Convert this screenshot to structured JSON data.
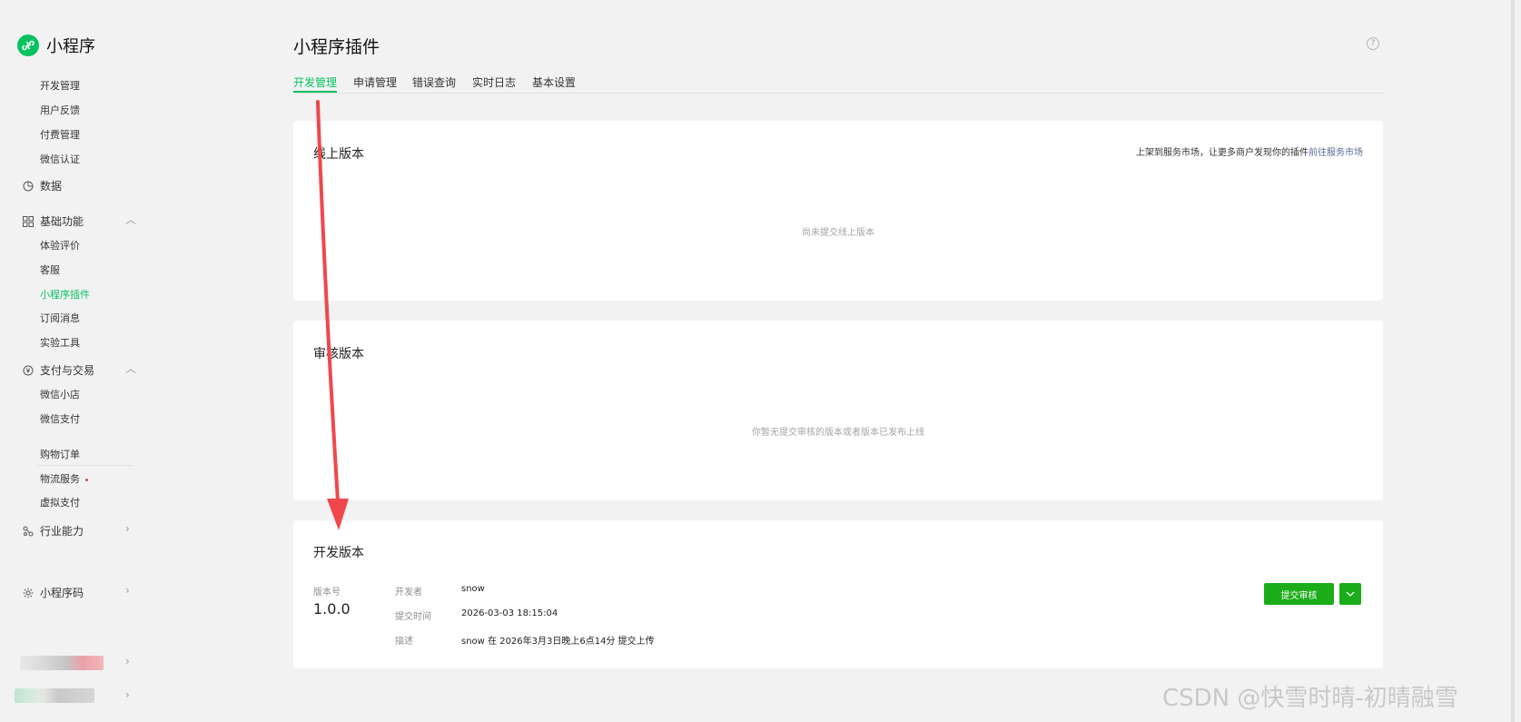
{
  "app": {
    "name": "小程序"
  },
  "sidebar": {
    "items_top": [
      {
        "label": "开发管理"
      },
      {
        "label": "用户反馈"
      },
      {
        "label": "付费管理"
      },
      {
        "label": "微信认证"
      }
    ],
    "data_group": {
      "label": "数据"
    },
    "basic_group": {
      "label": "基础功能"
    },
    "basic_items": [
      {
        "label": "体验评价"
      },
      {
        "label": "客服"
      },
      {
        "label": "小程序插件"
      },
      {
        "label": "订阅消息"
      },
      {
        "label": "实验工具"
      }
    ],
    "pay_group": {
      "label": "支付与交易"
    },
    "pay_items": [
      {
        "label": "微信小店"
      },
      {
        "label": "微信支付"
      },
      {
        "label": "购物订单"
      },
      {
        "label": "物流服务"
      },
      {
        "label": "虚拟支付"
      }
    ],
    "industry_group": {
      "label": "行业能力"
    },
    "qrcode_group": {
      "label": "小程序码"
    }
  },
  "page": {
    "title": "小程序插件",
    "tabs": [
      {
        "label": "开发管理"
      },
      {
        "label": "申请管理"
      },
      {
        "label": "错误查询"
      },
      {
        "label": "实时日志"
      },
      {
        "label": "基本设置"
      }
    ]
  },
  "online": {
    "title": "线上版本",
    "market_text": "上架到服务市场，让更多商户发现你的插件",
    "market_link": "前往服务市场",
    "empty": "尚未提交线上版本"
  },
  "review": {
    "title": "审核版本",
    "empty": "你暂无提交审核的版本或者版本已发布上线"
  },
  "dev": {
    "title": "开发版本",
    "version_label": "版本号",
    "version": "1.0.0",
    "developer_label": "开发者",
    "developer": "snow",
    "time_label": "提交时间",
    "time": "2026-03-03 18:15:04",
    "desc_label": "描述",
    "desc": "snow 在 2026年3月3日晚上6点14分 提交上传",
    "submit_button": "提交审核"
  },
  "watermark": "CSDN @快雪时晴-初晴融雪",
  "colors": {
    "accent": "#07c160",
    "button": "#1aad19",
    "link": "#576b95",
    "arrow": "#f0474c"
  }
}
